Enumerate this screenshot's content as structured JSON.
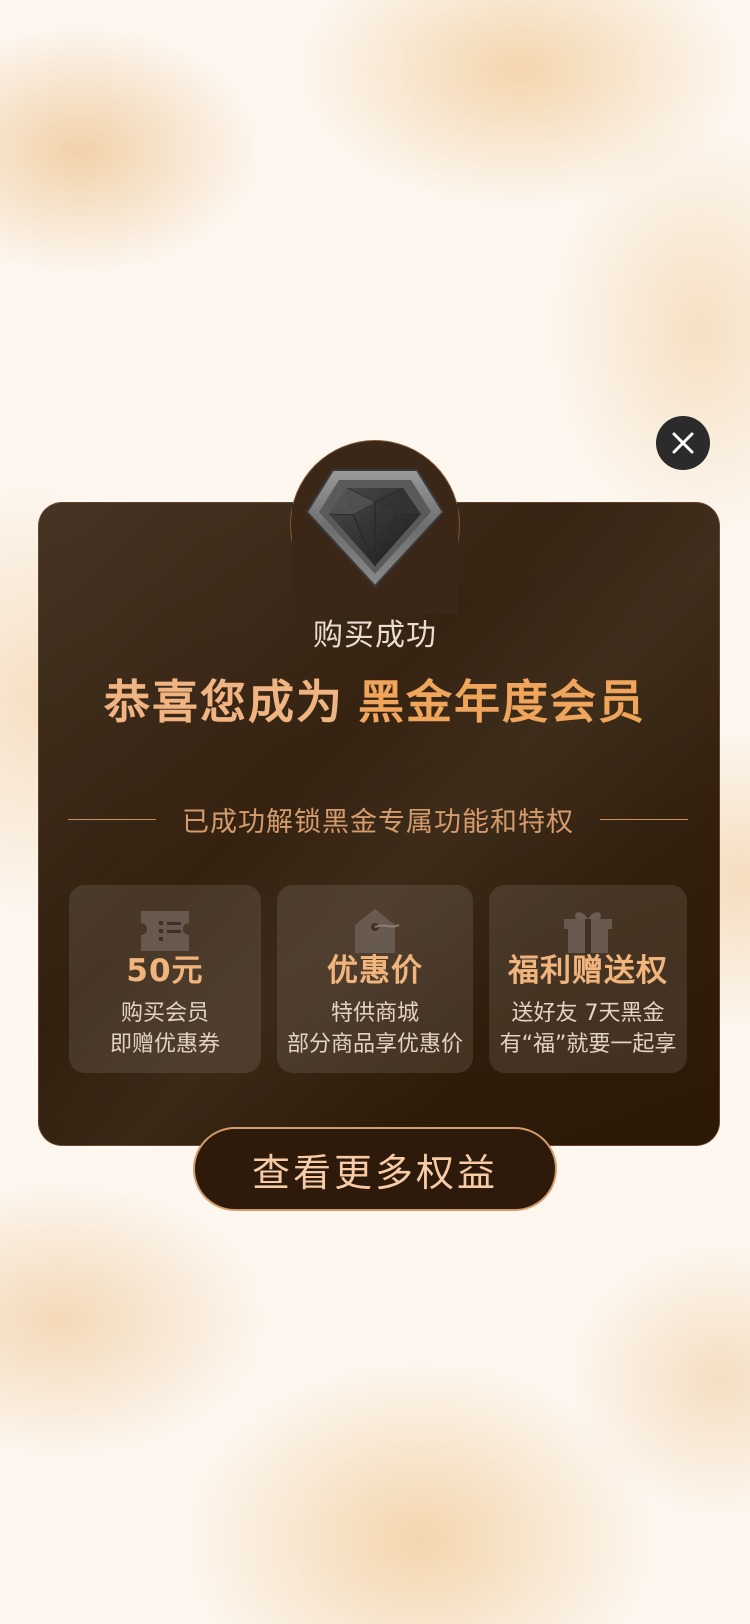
{
  "popup": {
    "purchase_title": "购买成功",
    "congrats_lead": "恭喜您成为",
    "tier_name": "黑金年度会员",
    "unlocked_text": "已成功解锁黑金专属功能和特权",
    "cta_label": "查看更多权益",
    "close_icon": "close-icon",
    "badge_icon": "diamond-badge-icon"
  },
  "benefits": [
    {
      "icon": "ticket-icon",
      "value": "50元",
      "line1": "购买会员",
      "line2": "即赠优惠券"
    },
    {
      "icon": "price-tag-icon",
      "value": "优惠价",
      "line1": "特供商城",
      "line2": "部分商品享优惠价"
    },
    {
      "icon": "gift-icon",
      "value": "福利赠送权",
      "line1": "送好友 7天黑金",
      "line2": "有“福”就要一起享"
    }
  ],
  "colors": {
    "card_background": "#34210f",
    "accent_gold": "#efa55b",
    "text_light": "#e9ddd2",
    "cta_border": "#d49c6c"
  }
}
